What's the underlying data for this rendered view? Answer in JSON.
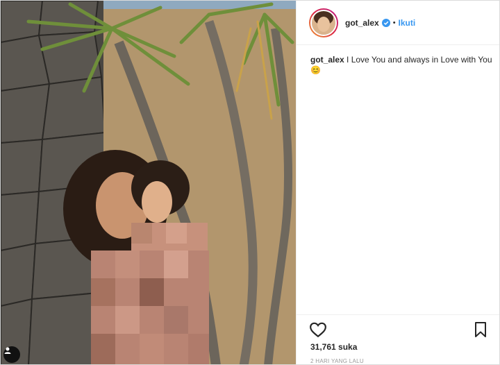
{
  "post": {
    "username": "got_alex",
    "follow_label": "Ikuti",
    "separator": "•",
    "caption_user": "got_alex",
    "caption_text": "I Love You and always in Love with You 😊",
    "likes": "31,761 suka",
    "timestamp": "2 HARI YANG LALU"
  },
  "icons": {
    "verified": "verified-badge-icon",
    "like": "heart-icon",
    "save": "bookmark-icon",
    "tag": "user-tag-icon"
  },
  "colors": {
    "follow_blue": "#3897f0",
    "verified_blue": "#3897f0",
    "text": "#262626",
    "muted": "#999999"
  }
}
